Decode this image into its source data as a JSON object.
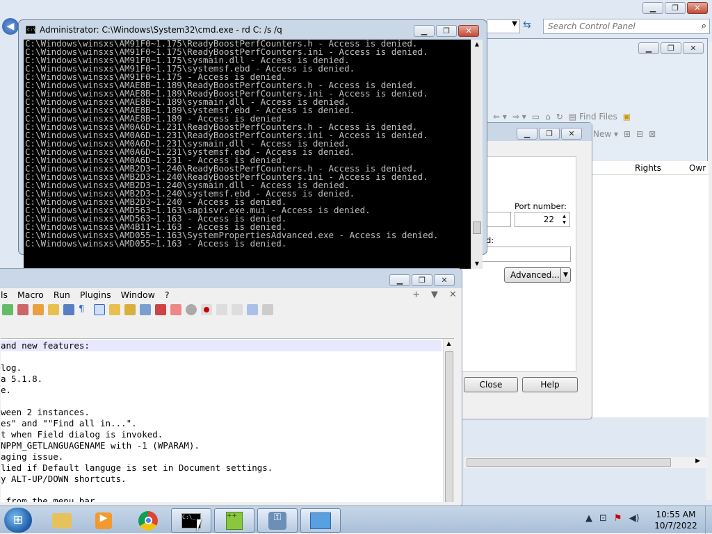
{
  "cmd": {
    "title": "Administrator: C:\\Windows\\System32\\cmd.exe - rd  C: /s /q",
    "icon": "C:\\",
    "lines": [
      "C:\\Windows\\winsxs\\AM91F0~1.175\\ReadyBoostPerfCounters.h - Access is denied.",
      "C:\\Windows\\winsxs\\AM91F0~1.175\\ReadyBoostPerfCounters.ini - Access is denied.",
      "C:\\Windows\\winsxs\\AM91F0~1.175\\sysmain.dll - Access is denied.",
      "C:\\Windows\\winsxs\\AM91F0~1.175\\systemsf.ebd - Access is denied.",
      "C:\\Windows\\winsxs\\AM91F0~1.175 - Access is denied.",
      "C:\\Windows\\winsxs\\AMAE8B~1.189\\ReadyBoostPerfCounters.h - Access is denied.",
      "C:\\Windows\\winsxs\\AMAE8B~1.189\\ReadyBoostPerfCounters.ini - Access is denied.",
      "C:\\Windows\\winsxs\\AMAE8B~1.189\\sysmain.dll - Access is denied.",
      "C:\\Windows\\winsxs\\AMAE8B~1.189\\systemsf.ebd - Access is denied.",
      "C:\\Windows\\winsxs\\AMAE8B~1.189 - Access is denied.",
      "C:\\Windows\\winsxs\\AM0A6D~1.231\\ReadyBoostPerfCounters.h - Access is denied.",
      "C:\\Windows\\winsxs\\AM0A6D~1.231\\ReadyBoostPerfCounters.ini - Access is denied.",
      "C:\\Windows\\winsxs\\AM0A6D~1.231\\sysmain.dll - Access is denied.",
      "C:\\Windows\\winsxs\\AM0A6D~1.231\\systemsf.ebd - Access is denied.",
      "C:\\Windows\\winsxs\\AM0A6D~1.231 - Access is denied.",
      "C:\\Windows\\winsxs\\AMB2D3~1.240\\ReadyBoostPerfCounters.h - Access is denied.",
      "C:\\Windows\\winsxs\\AMB2D3~1.240\\ReadyBoostPerfCounters.ini - Access is denied.",
      "C:\\Windows\\winsxs\\AMB2D3~1.240\\sysmain.dll - Access is denied.",
      "C:\\Windows\\winsxs\\AMB2D3~1.240\\systemsf.ebd - Access is denied.",
      "C:\\Windows\\winsxs\\AMB2D3~1.240 - Access is denied.",
      "C:\\Windows\\winsxs\\AMD563~1.163\\sapisvr.exe.mui - Access is denied.",
      "C:\\Windows\\winsxs\\AMD563~1.163 - Access is denied.",
      "C:\\Windows\\winsxs\\AM4B11~1.163 - Access is denied.",
      "C:\\Windows\\winsxs\\AMD055~1.163\\SystemPropertiesAdvanced.exe - Access is denied.",
      "C:\\Windows\\winsxs\\AMD055~1.163 - Access is denied."
    ]
  },
  "control_panel": {
    "search_placeholder": "Search Control Panel"
  },
  "explorer": {
    "find_files": "Find Files",
    "new_label": "New ▾",
    "col_rights": "Rights",
    "col_owner": "Owr"
  },
  "dialog": {
    "port_label": "Port number:",
    "port_value": "22",
    "d_label": "d:",
    "advanced": "Advanced...",
    "close": "Close",
    "help": "Help"
  },
  "npp": {
    "menu": [
      "ls",
      "Macro",
      "Run",
      "Plugins",
      "Window",
      "?"
    ],
    "lines": [
      "and new features:",
      "",
      "log.",
      "a 5.1.8.",
      "e.",
      "",
      "ween 2 instances.",
      "es\" and \"\"Find all in...\".",
      "t when Field dialog is invoked.",
      "NPPM_GETLANGUAGENAME with -1 (WPARAM).",
      "aging issue.",
      "lied if Default languge is set in Document settings.",
      "y ALT-UP/DOWN shortcuts.",
      "",
      " from the menu bar."
    ]
  },
  "taskbar": {
    "time": "10:55 AM",
    "date": "10/7/2022"
  }
}
